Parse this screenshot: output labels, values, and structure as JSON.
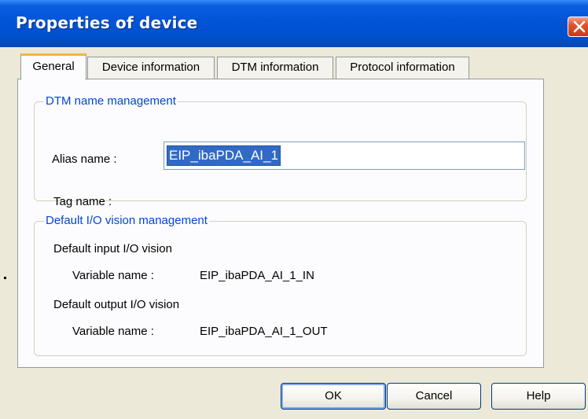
{
  "window": {
    "title": "Properties of device"
  },
  "tabs": [
    {
      "label": "General",
      "active": true
    },
    {
      "label": "Device information",
      "active": false
    },
    {
      "label": "DTM information",
      "active": false
    },
    {
      "label": "Protocol information",
      "active": false
    }
  ],
  "dtm_group": {
    "title": "DTM name management",
    "alias_label": "Alias name :",
    "alias_value": "EIP_ibaPDA_AI_1",
    "tag_label": "Tag name :"
  },
  "io_group": {
    "title": "Default I/O vision management",
    "input_heading": "Default input I/O vision",
    "input_var_label": "Variable name :",
    "input_var_value": "EIP_ibaPDA_AI_1_IN",
    "output_heading": "Default output I/O vision",
    "output_var_label": "Variable name :",
    "output_var_value": "EIP_ibaPDA_AI_1_OUT"
  },
  "buttons": {
    "ok": "OK",
    "cancel": "Cancel",
    "help": "Help"
  },
  "icons": {
    "close": "close-icon"
  },
  "colors": {
    "titlebar": "#0054e3",
    "group_title": "#0046d5",
    "selection": "#316ac5",
    "active_tab_accent": "#f6b53e",
    "close_button": "#e0542e"
  }
}
